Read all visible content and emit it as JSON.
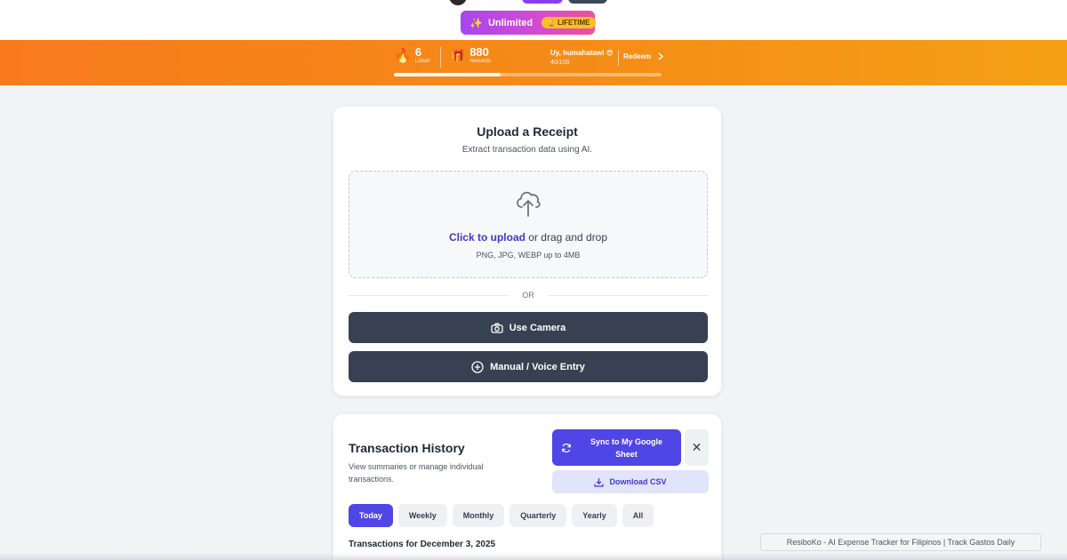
{
  "header": {
    "plan_label": "Unlimited",
    "plan_badge": "LIFETIME",
    "sparkle_icon": "sparkles-icon",
    "trophy_icon": "trophy-icon"
  },
  "gamification": {
    "streak_value": "6",
    "streak_label": "Laban",
    "streak_icon": "flame-icon",
    "rewards_value": "880",
    "rewards_label": "Rewards",
    "rewards_icon": "gift-icon",
    "rank_name": "Uy, humahatawl 😎",
    "rank_progress": "40/100",
    "progress_fraction": 0.4,
    "redeem_label": "Redeem",
    "redeem_icon": "chevron-right-icon"
  },
  "upload": {
    "title": "Upload a Receipt",
    "subtitle": "Extract transaction data using AI.",
    "click_link": "Click to upload",
    "drag_text": " or drag and drop",
    "formats": "PNG, JPG, WEBP up to 4MB",
    "or_label": "OR",
    "camera_label": "Use Camera",
    "manual_label": "Manual / Voice Entry",
    "icons": {
      "upload": "cloud-upload-icon",
      "camera": "camera-icon",
      "manual": "plus-circle-icon"
    }
  },
  "transactions": {
    "title": "Transaction History",
    "subtitle": "View summaries or manage individual transactions.",
    "sync_label": "Sync to My Google Sheet",
    "csv_label": "Download CSV",
    "close_label": "✕",
    "tabs": [
      "Today",
      "Weekly",
      "Monthly",
      "Quarterly",
      "Yearly",
      "All"
    ],
    "active_tab": "Today",
    "date_heading": "Transactions for December 3, 2025",
    "icons": {
      "sync": "refresh-icon",
      "csv": "download-icon",
      "close": "close-icon"
    }
  },
  "tooltip": {
    "text": "ResiboKo - AI Expense Tracker for Filipinos | Track Gastos Daily"
  },
  "colors": {
    "accent": "#4f46e5",
    "orange_start": "#f87a1c",
    "orange_end": "#f5a014",
    "dark_button": "#374151"
  }
}
